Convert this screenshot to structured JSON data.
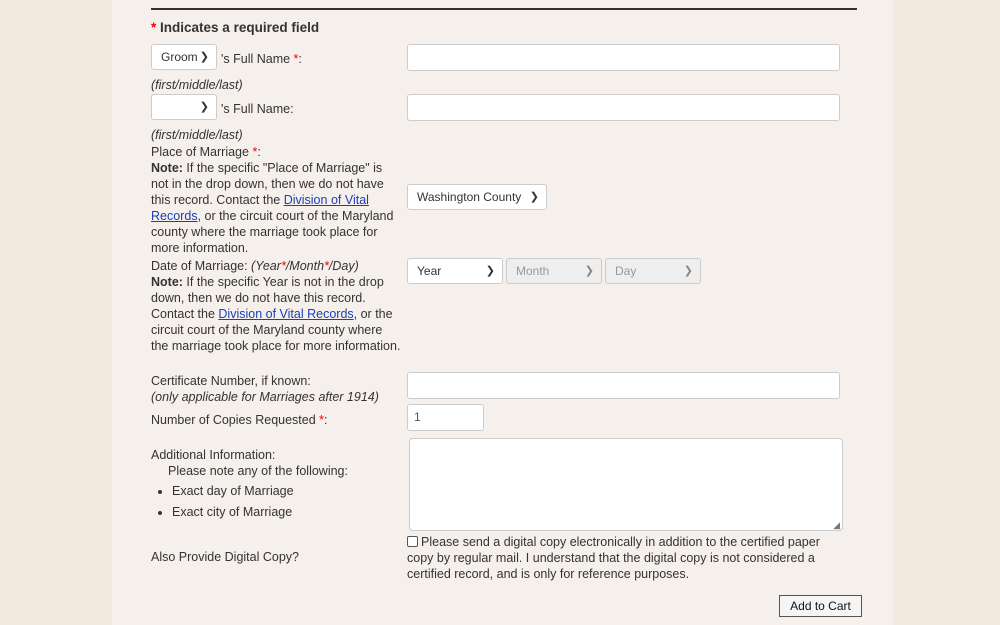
{
  "required_note": "Indicates a required field",
  "asterisk": "*",
  "party1": {
    "select": "Groom",
    "suffix": "'s Full Name ",
    "colon": ":",
    "hint": "(first/middle/last)"
  },
  "party2": {
    "select": "",
    "label": "'s Full Name:",
    "hint": "(first/middle/last)"
  },
  "place": {
    "label": "Place of Marriage ",
    "colon": ":",
    "note_bold": "Note:",
    "note1": " If the specific \"Place of Marriage\" is not in the drop down, then we do not have this record. Contact the ",
    "link": "Division of Vital Records",
    "note2": ", or the circuit court of the Maryland county where the marriage took place for more information.",
    "value": "Washington County"
  },
  "date": {
    "label": "Date of Marriage: ",
    "fmt1": "(Year",
    "fmt2": "/Month",
    "fmt3": "/Day)",
    "note_bold": "Note:",
    "note1": " If the specific Year is not in the drop down, then we do not have this record. Contact the ",
    "link": "Division of Vital Records",
    "note2": ", or the circuit court of the Maryland county where the marriage took place for more information.",
    "year": "Year",
    "month": "Month",
    "day": "Day"
  },
  "certificate": {
    "label": "Certificate Number, if known:",
    "hint": "(only applicable for Marriages after 1914)",
    "value": ""
  },
  "copies": {
    "label": "Number of Copies Requested ",
    "colon": ":",
    "value": "1"
  },
  "additional": {
    "label": "Additional Information:",
    "sub": "Please note any of the following:",
    "items": [
      "Exact day of Marriage",
      "Exact city of Marriage"
    ]
  },
  "digital": {
    "label": "Also Provide Digital Copy?",
    "checkbox_text": "Please send a digital copy electronically in addition to the certified paper copy by regular mail. I understand that the digital copy is not considered a certified record, and is only for reference purposes.",
    "checked": false
  },
  "add_to_cart": "Add to Cart"
}
